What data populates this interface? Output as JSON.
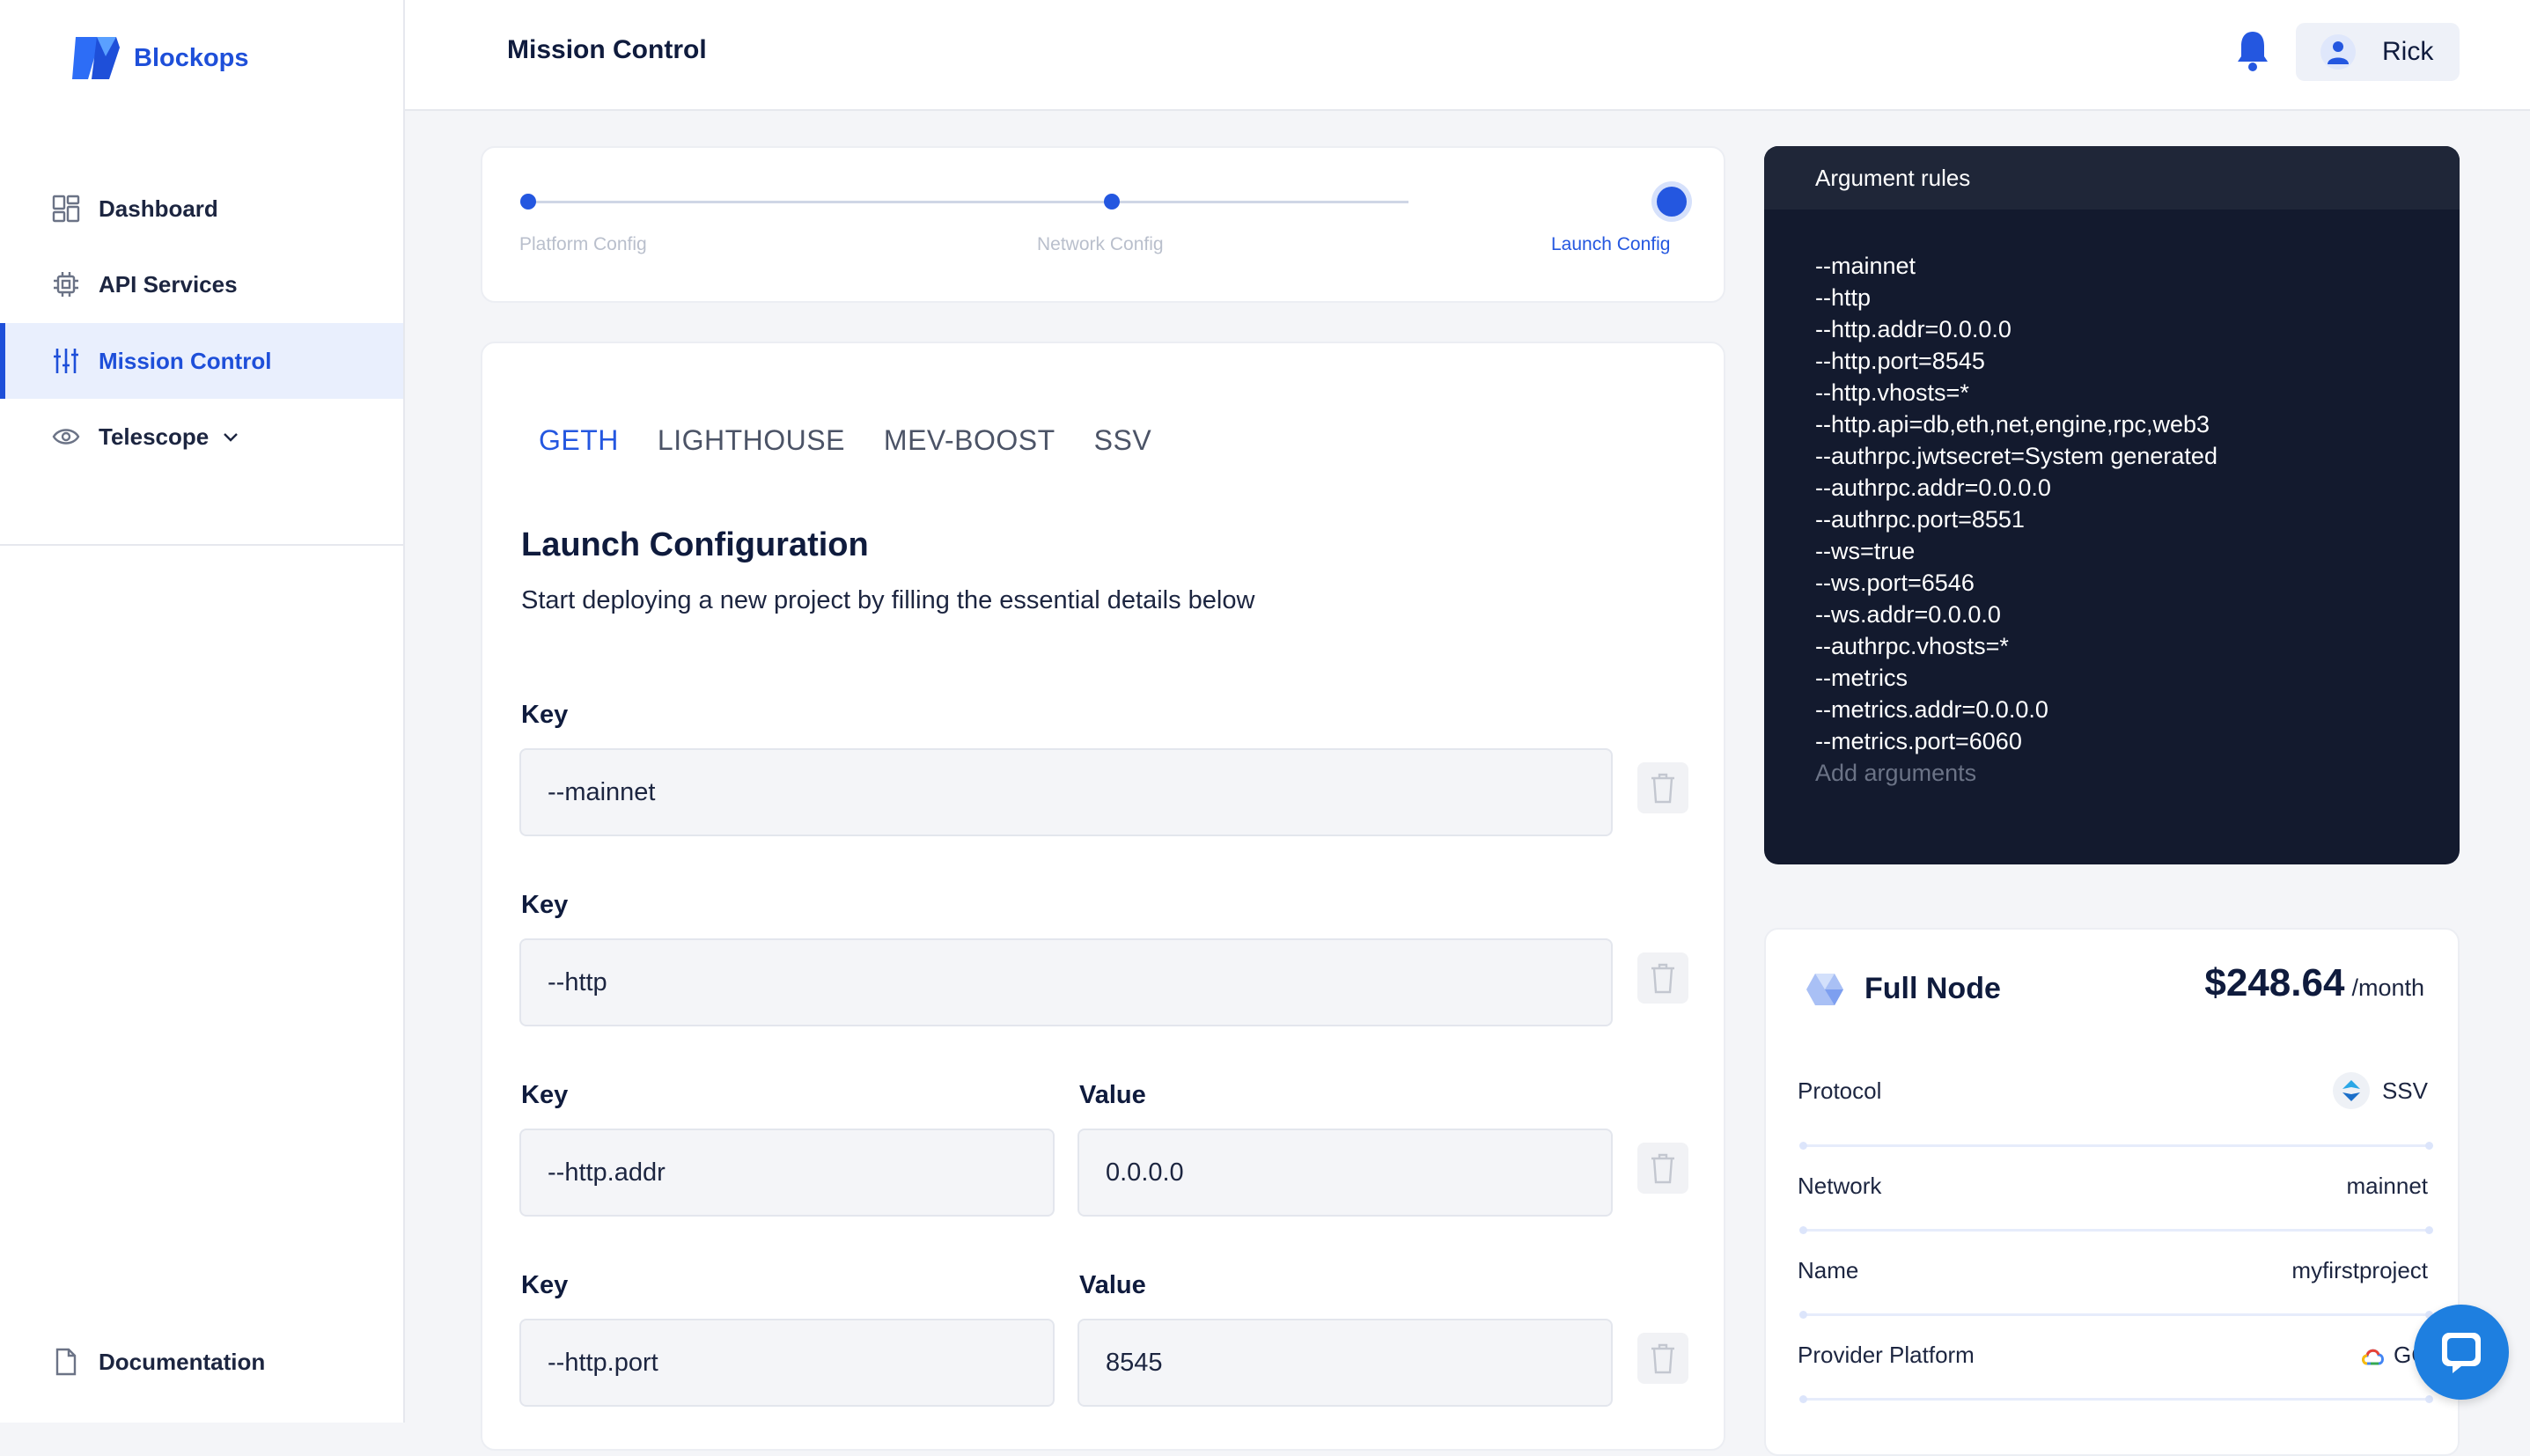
{
  "brand": {
    "name": "Blockops"
  },
  "sidebar": {
    "items": [
      {
        "label": "Dashboard",
        "icon": "dashboard-icon"
      },
      {
        "label": "API Services",
        "icon": "chip-icon"
      },
      {
        "label": "Mission Control",
        "icon": "sliders-icon",
        "active": true
      },
      {
        "label": "Telescope",
        "icon": "eye-icon"
      }
    ],
    "footer": {
      "label": "Documentation",
      "icon": "document-icon"
    }
  },
  "header": {
    "title": "Mission Control",
    "user": "Rick"
  },
  "stepper": {
    "steps": [
      "Platform Config",
      "Network Config",
      "Launch Config"
    ],
    "current": 3
  },
  "tabs": [
    "GETH",
    "LIGHTHOUSE",
    "MEV-BOOST",
    "SSV"
  ],
  "form": {
    "title": "Launch Configuration",
    "subtitle": "Start deploying a new project by filling the essential details below",
    "key_label": "Key",
    "value_label": "Value",
    "rows": [
      {
        "key": "--mainnet"
      },
      {
        "key": "--http"
      },
      {
        "key": "--http.addr",
        "value": "0.0.0.0"
      },
      {
        "key": "--http.port",
        "value": "8545"
      }
    ]
  },
  "argument_rules": {
    "title": "Argument rules",
    "lines": [
      "--mainnet",
      "--http",
      "--http.addr=0.0.0.0",
      "--http.port=8545",
      "--http.vhosts=*",
      "--http.api=db,eth,net,engine,rpc,web3",
      "--authrpc.jwtsecret=System generated",
      "--authrpc.addr=0.0.0.0",
      "--authrpc.port=8551",
      "--ws=true",
      "--ws.port=6546",
      "--ws.addr=0.0.0.0",
      "--authrpc.vhosts=*",
      "--metrics",
      "--metrics.addr=0.0.0.0",
      "--metrics.port=6060"
    ],
    "placeholder": "Add arguments"
  },
  "summary": {
    "title": "Full Node",
    "price": "$248.64",
    "price_unit": "/month",
    "rows": [
      {
        "label": "Protocol",
        "value": "SSV"
      },
      {
        "label": "Network",
        "value": "mainnet"
      },
      {
        "label": "Name",
        "value": "myfirstproject"
      },
      {
        "label": "Provider Platform",
        "value": "GC"
      }
    ]
  },
  "colors": {
    "accent": "#2457e0",
    "dark_panel": "#131a2e"
  }
}
